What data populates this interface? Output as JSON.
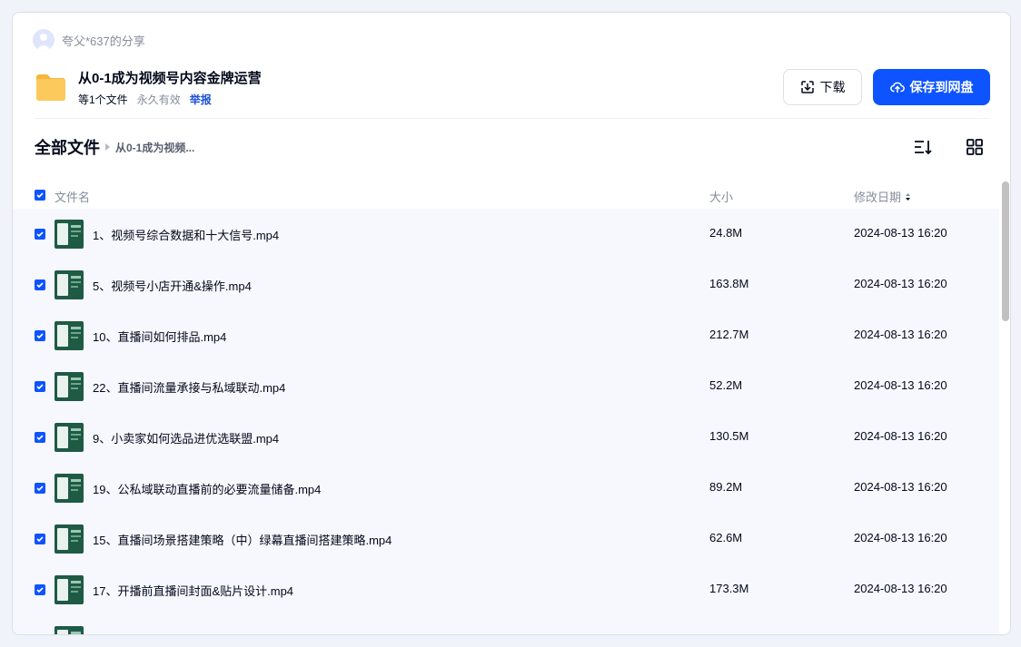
{
  "share": {
    "sharer_name": "夸父*637的分享",
    "title": "从0-1成为视频号内容金牌运营",
    "file_count": "等1个文件",
    "validity": "永久有效",
    "report_label": "举报"
  },
  "actions": {
    "download_label": "下载",
    "save_label": "保存到网盘"
  },
  "breadcrumb": {
    "root": "全部文件",
    "current": "从0-1成为视频..."
  },
  "table": {
    "headers": {
      "name": "文件名",
      "size": "大小",
      "date": "修改日期"
    },
    "rows": [
      {
        "name": "1、视频号综合数据和十大信号.mp4",
        "size": "24.8M",
        "date": "2024-08-13 16:20"
      },
      {
        "name": "5、视频号小店开通&操作.mp4",
        "size": "163.8M",
        "date": "2024-08-13 16:20"
      },
      {
        "name": "10、直播间如何排品.mp4",
        "size": "212.7M",
        "date": "2024-08-13 16:20"
      },
      {
        "name": "22、直播间流量承接与私域联动.mp4",
        "size": "52.2M",
        "date": "2024-08-13 16:20"
      },
      {
        "name": "9、小卖家如何选品进优选联盟.mp4",
        "size": "130.5M",
        "date": "2024-08-13 16:20"
      },
      {
        "name": "19、公私域联动直播前的必要流量储备.mp4",
        "size": "89.2M",
        "date": "2024-08-13 16:20"
      },
      {
        "name": "15、直播间场景搭建策略（中）绿幕直播间搭建策略.mp4",
        "size": "62.6M",
        "date": "2024-08-13 16:20"
      },
      {
        "name": "17、开播前直播间封面&贴片设计.mp4",
        "size": "173.3M",
        "date": "2024-08-13 16:20"
      },
      {
        "name": "",
        "size": "",
        "date": ""
      }
    ]
  },
  "colors": {
    "accent": "#0d53ff",
    "folder": "#fcc34f",
    "thumb": "#1f5a45"
  },
  "icons": {
    "avatar": "user-avatar-icon",
    "folder": "folder-icon",
    "download": "download-icon",
    "save": "cloud-upload-icon",
    "sort": "sort-icon",
    "grid": "grid-view-icon",
    "checkbox": "checkbox-checked-icon"
  }
}
